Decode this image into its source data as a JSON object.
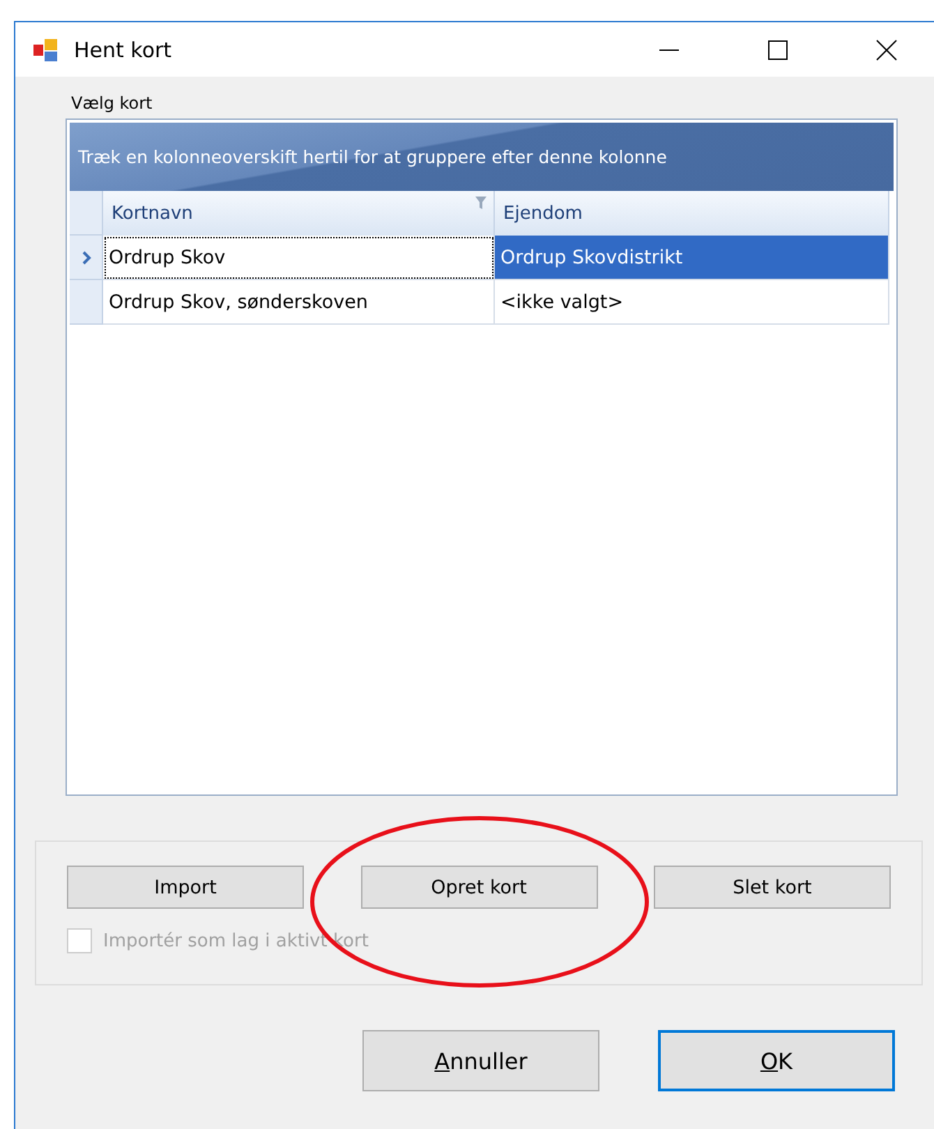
{
  "window": {
    "title": "Hent kort"
  },
  "grid": {
    "label": "Vælg kort",
    "group_panel": "Træk en kolonneoverskift hertil for at gruppere efter denne kolonne",
    "columns": [
      {
        "title": "Kortnavn",
        "filter": true
      },
      {
        "title": "Ejendom",
        "filter": false
      }
    ],
    "rows": [
      {
        "cells": [
          "Ordrup Skov",
          "Ordrup Skovdistrikt"
        ],
        "selected": true
      },
      {
        "cells": [
          "Ordrup Skov, sønderskoven",
          "<ikke valgt>"
        ],
        "selected": false
      }
    ]
  },
  "actions": [
    "Import",
    "Opret kort",
    "Slet kort"
  ],
  "import_option": {
    "label": "Importér som lag i aktivt kort",
    "checked": false,
    "disabled": true
  },
  "buttons": [
    {
      "label": "Annuller",
      "default": false,
      "underline_first": true
    },
    {
      "label": "OK",
      "default": true,
      "underline_first": true
    }
  ],
  "annotation": {
    "kind": "ellipse"
  }
}
